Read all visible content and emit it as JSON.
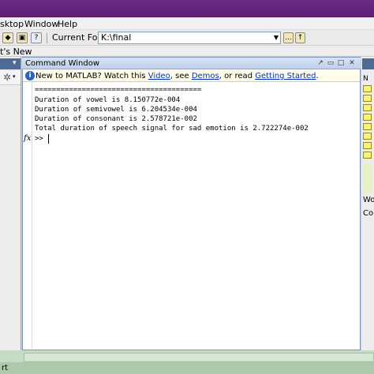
{
  "menu": {
    "items": [
      "sktop",
      "Window",
      "Help"
    ]
  },
  "toolbar": {
    "current_folder_label": "Current Folder:",
    "current_folder_value": "K:\\final",
    "browse_button": "...",
    "whats_new_label": "t's New"
  },
  "command_window": {
    "title": "Command Window",
    "info": {
      "prefix": "New to MATLAB? Watch this ",
      "video_link": "Video",
      "mid1": ", see ",
      "demos_link": "Demos",
      "mid2": ", or read ",
      "getting_started_link": "Getting Started",
      "suffix": "."
    },
    "lines": [
      "=======================================",
      "Duration of vowel is 8.150772e-004",
      "Duration of semivowel is 6.204534e-004",
      "Duration of consonant is 2.578721e-002",
      "Total duration of speech signal for sad emotion is 2.722274e-002"
    ],
    "fx_label": "fx",
    "prompt": ">>"
  },
  "right_pane": {
    "workspace_label": "Wo",
    "command_history_label": "Co"
  },
  "bottom": {
    "start_label": "rt"
  },
  "colors": {
    "title_bar": "#5a1f73",
    "panel_header": "#4e6b94",
    "link": "#0033cc",
    "info_bg": "#fffde7"
  }
}
